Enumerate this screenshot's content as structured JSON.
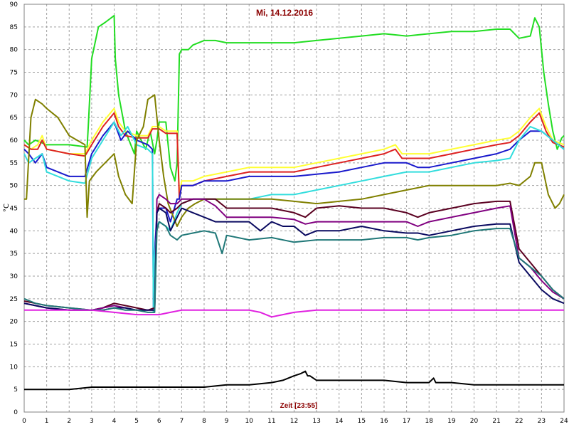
{
  "chart_data": {
    "type": "line",
    "title": "Mi, 14.12.2016",
    "xlabel": "Zeit [23:55]",
    "ylabel": "°C",
    "xlim": [
      0,
      24
    ],
    "ylim": [
      0,
      90
    ],
    "x_ticks": [
      0,
      1,
      2,
      3,
      4,
      5,
      6,
      7,
      8,
      9,
      10,
      11,
      12,
      13,
      14,
      15,
      16,
      17,
      18,
      19,
      20,
      21,
      22,
      23,
      24
    ],
    "y_ticks": [
      0,
      5,
      10,
      15,
      20,
      25,
      30,
      35,
      40,
      45,
      50,
      55,
      60,
      65,
      70,
      75,
      80,
      85,
      90
    ],
    "grid": true,
    "colors": {
      "grid": "#a0a0a0",
      "plot_background": "#ffffff",
      "title": "#8b0000",
      "x_label": "#8b0000"
    },
    "series": [
      {
        "color": "#22dd22",
        "x": [
          0,
          0.2,
          0.5,
          1.0,
          2.0,
          2.8,
          2.85,
          3.0,
          3.3,
          3.6,
          4.0,
          4.05,
          4.2,
          4.5,
          4.9,
          5.0,
          5.2,
          5.4,
          5.6,
          5.8,
          5.9,
          6.0,
          6.3,
          6.5,
          6.7,
          6.8,
          6.9,
          7.0,
          7.3,
          7.5,
          8.0,
          8.5,
          9.0,
          10.0,
          11.0,
          12.0,
          13.0,
          14.0,
          15.0,
          16.0,
          17.0,
          18.0,
          19.0,
          20.0,
          21.0,
          21.6,
          22.0,
          22.5,
          22.7,
          22.9,
          23.1,
          23.3,
          23.5,
          23.7,
          23.9,
          24.0
        ],
        "y": [
          60,
          59,
          60,
          59,
          59,
          58.5,
          63,
          78,
          85,
          86,
          87.5,
          78,
          70,
          62,
          57,
          62,
          60,
          58,
          62,
          57,
          60,
          64,
          64,
          54,
          51,
          55,
          79,
          80,
          80,
          81,
          82,
          82,
          81.5,
          81.5,
          81.5,
          81.5,
          82,
          82.5,
          83,
          83.5,
          83,
          83.5,
          84,
          84,
          84.5,
          84.5,
          82.5,
          83,
          87,
          85,
          75,
          68,
          62,
          58,
          60.5,
          61
        ]
      },
      {
        "color": "#ffff33",
        "x": [
          0,
          0.3,
          0.6,
          0.8,
          1.0,
          2.0,
          2.7,
          3.0,
          3.5,
          4.0,
          4.2,
          4.5,
          5.0,
          5.5,
          5.7,
          6.0,
          6.3,
          6.8,
          6.9,
          7.0,
          7.5,
          8.0,
          9.0,
          10.0,
          11.0,
          12.0,
          13.0,
          14.0,
          15.0,
          16.0,
          16.5,
          16.8,
          17.0,
          17.5,
          18.0,
          19.0,
          20.0,
          21.0,
          21.6,
          22.0,
          22.5,
          22.9,
          23.2,
          23.5,
          24.0
        ],
        "y": [
          59,
          58,
          59,
          61,
          58,
          57,
          57,
          60,
          64,
          67,
          64,
          62,
          61,
          61,
          63,
          63,
          62,
          62,
          48,
          51,
          51,
          52,
          53,
          54,
          54,
          54,
          55,
          56,
          57,
          58,
          59,
          57,
          57,
          57,
          57,
          58,
          59,
          60,
          60.5,
          62,
          65,
          67,
          63,
          60,
          59
        ]
      },
      {
        "color": "#dd2222",
        "x": [
          0,
          0.3,
          0.6,
          0.8,
          1.0,
          2.0,
          2.7,
          3.0,
          3.5,
          4.0,
          4.2,
          4.5,
          5.0,
          5.5,
          5.7,
          6.0,
          6.3,
          6.8,
          6.9,
          7.0,
          7.5,
          8.0,
          9.0,
          10.0,
          11.0,
          12.0,
          13.0,
          14.0,
          15.0,
          16.0,
          16.5,
          16.8,
          17.0,
          17.5,
          18.0,
          19.0,
          20.0,
          21.0,
          21.6,
          22.0,
          22.5,
          22.9,
          23.2,
          23.5,
          24.0
        ],
        "y": [
          59,
          58,
          58,
          60,
          58,
          57,
          56.5,
          59,
          63,
          66,
          63,
          61,
          60.5,
          60.5,
          62.5,
          62.5,
          61.5,
          61.5,
          47,
          50,
          50,
          51,
          52,
          53,
          53,
          53,
          54,
          55,
          56,
          57,
          58,
          56,
          56,
          56,
          56,
          57,
          58,
          59,
          59.5,
          61,
          64,
          66,
          62,
          59.5,
          58.5
        ]
      },
      {
        "color": "#1a1acc",
        "x": [
          0,
          0.2,
          0.5,
          0.8,
          1.0,
          2.0,
          2.7,
          3.0,
          3.5,
          4.0,
          4.3,
          4.6,
          5.0,
          5.5,
          5.7,
          5.75,
          5.8,
          5.9,
          6.0,
          6.3,
          6.5,
          6.8,
          6.9,
          7.0,
          7.5,
          8.0,
          9.0,
          10.0,
          11.0,
          12.0,
          13.0,
          14.0,
          15.0,
          16.0,
          17.0,
          17.5,
          18.0,
          19.0,
          20.0,
          21.0,
          21.6,
          22.0,
          22.5,
          23.0,
          23.5,
          24.0
        ],
        "y": [
          58,
          57,
          55,
          57,
          54,
          52,
          52,
          57,
          61,
          64,
          60,
          62,
          60,
          59,
          58,
          22,
          35,
          44,
          45,
          45,
          42,
          47,
          47,
          50,
          50,
          51,
          51,
          52,
          52,
          52,
          52.5,
          53,
          54,
          55,
          55,
          54,
          54,
          55,
          56,
          57,
          58,
          60,
          62,
          62,
          60,
          58
        ]
      },
      {
        "color": "#33dddd",
        "x": [
          0,
          0.2,
          0.5,
          0.8,
          1.0,
          2.0,
          2.7,
          3.0,
          3.5,
          4.0,
          4.3,
          4.6,
          5.0,
          5.5,
          5.7,
          5.75,
          5.8,
          5.9,
          6.0,
          6.3,
          6.5,
          6.8,
          7.0,
          7.5,
          8.0,
          9.0,
          10.0,
          11.0,
          12.0,
          13.0,
          14.0,
          15.0,
          16.0,
          17.0,
          18.0,
          19.0,
          20.0,
          21.0,
          21.6,
          22.0,
          22.5,
          23.0,
          23.5,
          24.0
        ],
        "y": [
          57,
          55,
          56,
          57,
          53,
          51,
          50.5,
          56,
          60,
          64,
          61,
          63,
          59,
          58,
          57,
          22,
          34,
          41,
          42,
          41,
          40,
          44,
          46,
          47,
          47,
          47,
          47,
          48,
          48,
          49,
          50,
          51,
          52,
          53,
          53,
          54,
          55,
          55.5,
          56,
          60,
          63,
          62,
          60,
          58
        ]
      },
      {
        "color": "#808000",
        "x": [
          0,
          0.1,
          0.3,
          0.5,
          0.8,
          1.0,
          1.5,
          2.0,
          2.7,
          2.8,
          2.9,
          3.2,
          3.6,
          4.0,
          4.2,
          4.5,
          4.8,
          5.0,
          5.3,
          5.5,
          5.8,
          5.9,
          6.0,
          6.2,
          6.4,
          6.8,
          7.0,
          7.3,
          7.6,
          8.0,
          9.0,
          10.0,
          11.0,
          12.0,
          13.0,
          14.0,
          15.0,
          16.0,
          17.0,
          18.0,
          19.0,
          20.0,
          21.0,
          21.6,
          22.0,
          22.5,
          22.7,
          23.0,
          23.3,
          23.6,
          23.8,
          24.0
        ],
        "y": [
          47,
          47,
          65,
          69,
          68,
          67,
          65,
          61,
          59,
          43,
          51,
          53,
          55,
          57,
          52,
          48,
          46,
          60,
          63,
          69,
          70,
          65,
          60,
          52,
          46,
          41,
          43,
          45,
          46,
          47,
          47,
          47,
          47,
          46.5,
          46,
          46.5,
          47,
          48,
          49,
          50,
          50,
          50,
          50,
          50.5,
          50,
          52,
          55,
          55,
          48,
          45,
          46,
          48
        ]
      },
      {
        "color": "#5a0020",
        "x": [
          0,
          0.5,
          1.0,
          2.0,
          3.0,
          3.5,
          4.0,
          4.5,
          5.0,
          5.5,
          5.8,
          5.9,
          6.0,
          6.3,
          6.5,
          6.8,
          7.0,
          7.5,
          8.0,
          8.5,
          9.0,
          10.0,
          11.0,
          12.0,
          12.5,
          13.0,
          14.0,
          15.0,
          16.0,
          17.0,
          17.5,
          18.0,
          19.0,
          20.0,
          21.0,
          21.6,
          22.0,
          22.5,
          23.0,
          23.5,
          24.0
        ],
        "y": [
          24.5,
          24,
          23.5,
          23,
          22.5,
          23,
          24,
          23.5,
          23,
          22.5,
          23,
          44,
          46,
          45,
          44,
          45,
          46,
          47,
          47,
          47,
          45,
          45,
          45,
          44,
          43,
          45,
          45.5,
          45,
          45,
          44,
          43,
          44,
          45,
          46,
          46.5,
          46.5,
          36,
          33,
          30,
          27,
          25
        ]
      },
      {
        "color": "#800080",
        "x": [
          0,
          0.5,
          1.0,
          2.0,
          3.0,
          3.5,
          4.0,
          4.5,
          5.0,
          5.5,
          5.8,
          5.9,
          6.0,
          6.3,
          6.5,
          6.8,
          7.0,
          7.5,
          8.0,
          8.5,
          9.0,
          10.0,
          11.0,
          12.0,
          12.5,
          13.0,
          14.0,
          15.0,
          16.0,
          17.0,
          17.5,
          18.0,
          19.0,
          20.0,
          21.0,
          21.6,
          22.0,
          22.5,
          23.0,
          23.5,
          24.0
        ],
        "y": [
          24,
          23.5,
          23,
          22.5,
          22.5,
          23,
          23.5,
          23,
          22.5,
          22.5,
          22.5,
          47,
          48,
          47,
          46,
          46,
          47,
          47,
          47,
          45.5,
          43,
          43,
          43,
          42.5,
          41.5,
          42,
          42,
          42,
          42,
          42,
          41,
          42,
          43,
          44,
          45,
          45.5,
          34,
          32,
          29,
          26.5,
          25
        ]
      },
      {
        "color": "#0a0a60",
        "x": [
          0,
          0.5,
          1.0,
          2.0,
          3.0,
          3.5,
          4.0,
          4.5,
          5.0,
          5.5,
          5.8,
          5.9,
          6.0,
          6.3,
          6.5,
          6.8,
          7.0,
          7.5,
          8.0,
          8.5,
          9.0,
          10.0,
          10.5,
          11.0,
          11.5,
          12.0,
          12.5,
          13.0,
          14.0,
          15.0,
          16.0,
          17.0,
          17.5,
          18.0,
          19.0,
          20.0,
          21.0,
          21.6,
          22.0,
          22.5,
          23.0,
          23.5,
          24.0
        ],
        "y": [
          24,
          23.5,
          23,
          22.5,
          22.5,
          22.5,
          23,
          23,
          22.5,
          22.5,
          22.5,
          44,
          45,
          44,
          40,
          43,
          45,
          44,
          43,
          42,
          42,
          42,
          40,
          42,
          41,
          41,
          39,
          40,
          40,
          41,
          40,
          39.5,
          39.5,
          39,
          40,
          41,
          41.5,
          41.5,
          33,
          30,
          27,
          25,
          24
        ]
      },
      {
        "color": "#207878",
        "x": [
          0,
          0.5,
          1.0,
          2.0,
          3.0,
          3.5,
          4.0,
          4.5,
          5.0,
          5.5,
          5.8,
          5.9,
          6.0,
          6.3,
          6.5,
          6.8,
          7.0,
          7.5,
          8.0,
          8.5,
          8.8,
          9.0,
          10.0,
          11.0,
          12.0,
          13.0,
          14.0,
          15.0,
          16.0,
          17.0,
          17.5,
          18.0,
          19.0,
          20.0,
          21.0,
          21.6,
          22.0,
          22.5,
          23.0,
          23.5,
          24.0
        ],
        "y": [
          25,
          24,
          23.5,
          23,
          22.5,
          22.5,
          23,
          22.5,
          22.5,
          22,
          22,
          40,
          42,
          41,
          39,
          38,
          39,
          39.5,
          40,
          39.5,
          35,
          39,
          38,
          38.5,
          37.5,
          38,
          38,
          38,
          38.5,
          38.5,
          38,
          38.5,
          39,
          40,
          40.5,
          40.5,
          34,
          32,
          30,
          27,
          25
        ]
      },
      {
        "color": "#e020e0",
        "x": [
          0,
          1.0,
          2.0,
          3.0,
          4.0,
          5.0,
          6.0,
          6.5,
          7.0,
          8.0,
          9.0,
          10.0,
          10.5,
          11.0,
          11.5,
          12.0,
          13.0,
          14.0,
          15.0,
          16.0,
          17.0,
          18.0,
          19.0,
          20.0,
          21.0,
          22.0,
          23.0,
          24.0
        ],
        "y": [
          22.5,
          22.5,
          22.5,
          22.5,
          22,
          21.5,
          21.5,
          22,
          22.5,
          22.5,
          22.5,
          22.5,
          22,
          21,
          21.5,
          22,
          22.5,
          22.5,
          22.5,
          22.5,
          22.5,
          22.5,
          22.5,
          22.5,
          22.5,
          22.5,
          22.5,
          22.5
        ]
      },
      {
        "color": "#000000",
        "x": [
          0,
          1.0,
          2.0,
          3.0,
          4.0,
          5.0,
          6.0,
          7.0,
          8.0,
          9.0,
          10.0,
          11.0,
          11.5,
          12.0,
          12.3,
          12.5,
          12.6,
          12.7,
          13.0,
          14.0,
          15.0,
          16.0,
          17.0,
          18.0,
          18.2,
          18.3,
          18.5,
          19.0,
          20.0,
          21.0,
          22.0,
          23.0,
          24.0
        ],
        "y": [
          5,
          5,
          5,
          5.5,
          5.5,
          5.5,
          5.5,
          5.5,
          5.5,
          6,
          6,
          6.5,
          7,
          8,
          8.5,
          9,
          8,
          8,
          7,
          7,
          7,
          7,
          6.5,
          6.5,
          7.5,
          6.5,
          6.5,
          6.5,
          6,
          6,
          6,
          6,
          6
        ]
      }
    ]
  }
}
